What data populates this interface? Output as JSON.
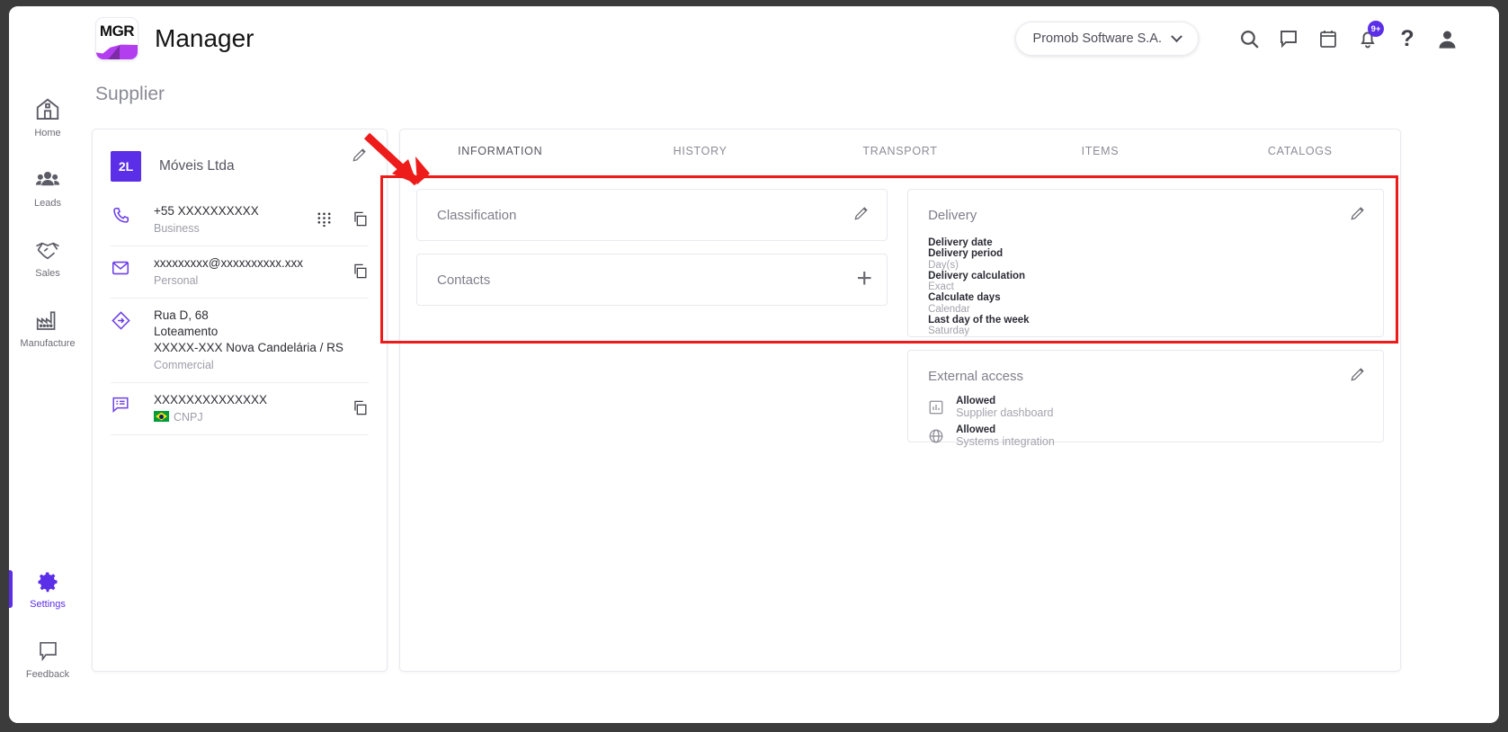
{
  "header": {
    "app_title": "Manager",
    "logo_text": "MGR",
    "org_selector": {
      "label": "Promob Software S.A.",
      "icon": "chevron-down-icon"
    },
    "icons": [
      {
        "name": "search-icon",
        "label": "Search"
      },
      {
        "name": "chat-icon",
        "label": "Messages"
      },
      {
        "name": "calendar-icon",
        "label": "Calendar"
      },
      {
        "name": "bell-icon",
        "label": "Notifications",
        "badge": "9+"
      },
      {
        "name": "help-icon",
        "label": "?"
      },
      {
        "name": "account-icon",
        "label": "Account"
      }
    ]
  },
  "sidebar": {
    "items": [
      {
        "label": "Home",
        "icon": "home-icon",
        "active": false
      },
      {
        "label": "Leads",
        "icon": "leads-icon",
        "active": false
      },
      {
        "label": "Sales",
        "icon": "handshake-icon",
        "active": false
      },
      {
        "label": "Manufacture",
        "icon": "factory-icon",
        "active": false
      }
    ],
    "bottom_items": [
      {
        "label": "Settings",
        "icon": "gear-icon",
        "active": true
      },
      {
        "label": "Feedback",
        "icon": "feedback-icon",
        "active": false
      }
    ]
  },
  "page": {
    "title": "Supplier"
  },
  "supplier_card": {
    "avatar_initials": "2L",
    "name": "Móveis Ltda",
    "edit_icon": "pencil-icon",
    "rows": [
      {
        "icon": "phone-icon",
        "value": "+55 XXXXXXXXXX",
        "label": "Business",
        "actions": [
          "dialpad-icon",
          "copy-icon"
        ]
      },
      {
        "icon": "email-icon",
        "value": "xxxxxxxxx@xxxxxxxxxx.xxx",
        "label": "Personal",
        "actions": [
          "copy-icon"
        ]
      },
      {
        "icon": "address-icon",
        "value_line1": "Rua D, 68",
        "value_line2": "Loteamento",
        "value_line3": "XXXXX-XXX Nova Candelária / RS",
        "label": "Commercial",
        "actions": []
      },
      {
        "icon": "document-icon",
        "value": "XXXXXXXXXXXXXX",
        "label": "CNPJ",
        "flag": "brazil-flag",
        "actions": [
          "copy-icon"
        ]
      }
    ]
  },
  "tabs": [
    {
      "label": "INFORMATION",
      "active": true
    },
    {
      "label": "HISTORY",
      "active": false
    },
    {
      "label": "TRANSPORT",
      "active": false
    },
    {
      "label": "ITEMS",
      "active": false
    },
    {
      "label": "CATALOGS",
      "active": false
    }
  ],
  "panels": {
    "classification": {
      "title": "Classification",
      "action_icon": "pencil-icon"
    },
    "contacts": {
      "title": "Contacts",
      "action_icon": "plus-icon"
    },
    "delivery": {
      "title": "Delivery",
      "action_icon": "pencil-icon",
      "fields": [
        {
          "key": "Delivery date",
          "value": ""
        },
        {
          "key": "Delivery period",
          "value": "Day(s)"
        },
        {
          "key": "Delivery calculation",
          "value": "Exact"
        },
        {
          "key": "Calculate days",
          "value": "Calendar"
        },
        {
          "key": "Last day of the week",
          "value": "Saturday"
        }
      ]
    },
    "external_access": {
      "title": "External access",
      "action_icon": "pencil-icon",
      "rows": [
        {
          "icon": "chart-icon",
          "status": "Allowed",
          "label": "Supplier dashboard"
        },
        {
          "icon": "globe-icon",
          "status": "Allowed",
          "label": "Systems integration"
        }
      ]
    }
  },
  "annotation": {
    "color": "#ee1b1b",
    "shape": "rectangle-with-arrow"
  }
}
